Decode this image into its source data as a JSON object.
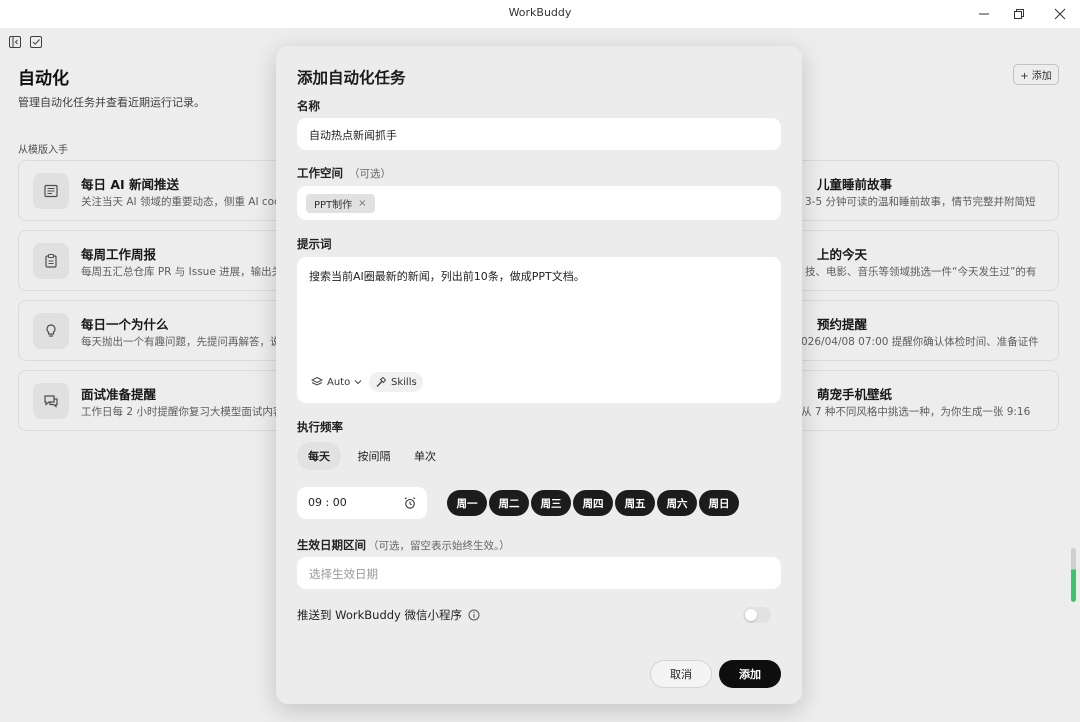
{
  "window": {
    "title": "WorkBuddy"
  },
  "page": {
    "title": "自动化",
    "subtitle": "管理自动化任务并查看近期运行记录。",
    "add_button": "+ 添加",
    "template_section_label": "从模版入手"
  },
  "cards_left": [
    {
      "icon": "newspaper-icon",
      "title": "每日 AI 新闻推送",
      "desc": "关注当天 AI 领域的重要动态，侧重 AI cod"
    },
    {
      "icon": "clipboard-icon",
      "title": "每周工作周报",
      "desc": "每周五汇总仓库 PR 与 Issue 进展，输出关"
    },
    {
      "icon": "lightbulb-icon",
      "title": "每日一个为什么",
      "desc": "每天抛出一个有趣问题，先提问再解答，说"
    },
    {
      "icon": "chat-icon",
      "title": "面试准备提醒",
      "desc": "工作日每 2 小时提醒你复习大模型面试内容"
    }
  ],
  "cards_right": [
    {
      "title": "儿童睡前故事",
      "desc": "3-5 分钟可读的温和睡前故事，情节完整并附简短"
    },
    {
      "title": "上的今天",
      "desc": "技、电影、音乐等领域挑选一件“今天发生过”的有"
    },
    {
      "title": "预约提醒",
      "desc": "026/04/08 07:00 提醒你确认体检时间、准备证件"
    },
    {
      "title": "萌宠手机壁纸",
      "desc": "从 7 种不同风格中挑选一种，为你生成一张 9:16"
    }
  ],
  "modal": {
    "title": "添加自动化任务",
    "name_label": "名称",
    "name_value": "自动热点新闻抓手",
    "workspace_label": "工作空间",
    "workspace_optional": "（可选）",
    "workspace_chip": "PPT制作",
    "workspace_chip_remove": "×",
    "prompt_label": "提示词",
    "prompt_value": "搜索当前AI圈最新的新闻，列出前10条，做成PPT文档。",
    "model_selector": "Auto",
    "skills_label": "Skills",
    "frequency_label": "执行频率",
    "frequency_tabs": [
      "每天",
      "按间隔",
      "单次"
    ],
    "frequency_selected": "每天",
    "time_value": "09 : 00",
    "weekdays": [
      "周一",
      "周二",
      "周三",
      "周四",
      "周五",
      "周六",
      "周日"
    ],
    "date_range_label": "生效日期区间",
    "date_range_hint": "（可选，留空表示始终生效。）",
    "date_range_placeholder": "选择生效日期",
    "push_label": "推送到 WorkBuddy 微信小程序",
    "push_enabled": false,
    "cancel_button": "取消",
    "submit_button": "添加"
  },
  "colors": {
    "modal_bg": "#ececec",
    "primary_button": "#0e0e0e",
    "weekday_selected": "#1c1c1c"
  }
}
